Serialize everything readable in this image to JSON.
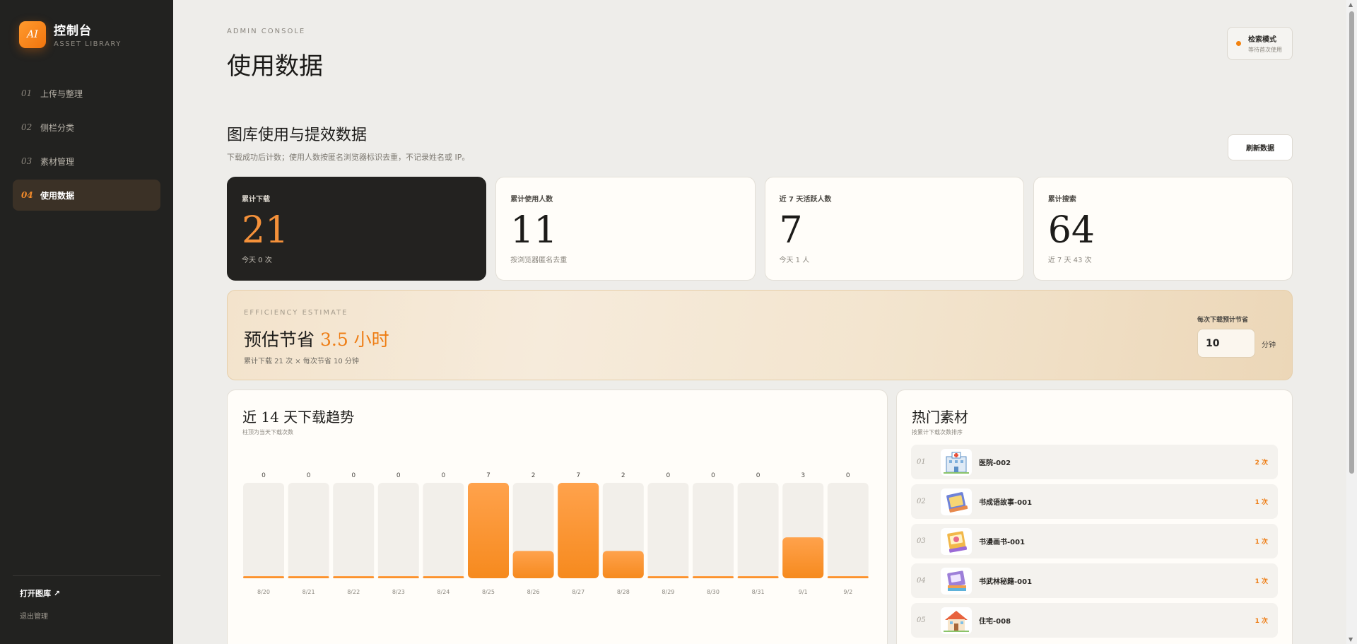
{
  "brand": {
    "logo_text": "AI",
    "title": "控制台",
    "subtitle": "ASSET LIBRARY"
  },
  "nav": [
    {
      "num": "01",
      "label": "上传与整理",
      "active": false
    },
    {
      "num": "02",
      "label": "侧栏分类",
      "active": false
    },
    {
      "num": "03",
      "label": "素材管理",
      "active": false
    },
    {
      "num": "04",
      "label": "使用数据",
      "active": true
    }
  ],
  "sidebar_footer": {
    "open_library": "打开图库 ↗",
    "logout": "退出管理"
  },
  "header": {
    "eyebrow": "ADMIN CONSOLE",
    "title": "使用数据"
  },
  "mode": {
    "title": "检索模式",
    "subtitle": "等待首次使用",
    "dot_color": "#f2820f"
  },
  "section": {
    "title": "图库使用与提效数据",
    "description": "下载成功后计数；使用人数按匿名浏览器标识去重，不记录姓名或 IP。",
    "refresh_label": "刷新数据"
  },
  "stats": [
    {
      "label": "累计下载",
      "value": "21",
      "note": "今天 0 次"
    },
    {
      "label": "累计使用人数",
      "value": "11",
      "note": "按浏览器匿名去重"
    },
    {
      "label": "近 7 天活跃人数",
      "value": "7",
      "note": "今天 1 人"
    },
    {
      "label": "累计搜索",
      "value": "64",
      "note": "近 7 天 43 次"
    }
  ],
  "efficiency": {
    "eyebrow": "EFFICIENCY ESTIMATE",
    "title_prefix": "预估节省",
    "hours": "3.5 小时",
    "note": "累计下载 21 次 × 每次节省 10 分钟",
    "input_label": "每次下载预计节省",
    "input_value": "10",
    "unit": "分钟"
  },
  "trend": {
    "title": "近 14 天下载趋势",
    "description": "柱顶为当天下载次数"
  },
  "chart_data": {
    "type": "bar",
    "categories": [
      "8/20",
      "8/21",
      "8/22",
      "8/23",
      "8/24",
      "8/25",
      "8/26",
      "8/27",
      "8/28",
      "8/29",
      "8/30",
      "8/31",
      "9/1",
      "9/2"
    ],
    "values": [
      0,
      0,
      0,
      0,
      0,
      7,
      2,
      7,
      2,
      0,
      0,
      0,
      3,
      0
    ],
    "title": "近 14 天下载趋势",
    "ylim": [
      0,
      7
    ],
    "colors": {
      "bar": "#f68a1e",
      "track": "#f2efea"
    }
  },
  "hot": {
    "title": "热门素材",
    "description": "按累计下载次数排序",
    "items": [
      {
        "rank": "01",
        "name": "医院-002",
        "count": "2 次",
        "icon": "hospital-icon"
      },
      {
        "rank": "02",
        "name": "书成语故事-001",
        "count": "1 次",
        "icon": "book-icon"
      },
      {
        "rank": "03",
        "name": "书漫画书-001",
        "count": "1 次",
        "icon": "comic-book-icon"
      },
      {
        "rank": "04",
        "name": "书武林秘籍-001",
        "count": "1 次",
        "icon": "book-stack-icon"
      },
      {
        "rank": "05",
        "name": "住宅-008",
        "count": "1 次",
        "icon": "house-icon"
      }
    ]
  }
}
